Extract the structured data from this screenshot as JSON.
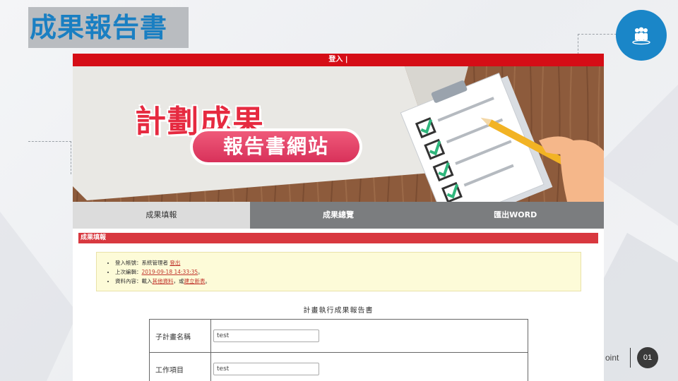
{
  "slide": {
    "title": "成果報告書",
    "footer_label": "oint",
    "page_number": "01",
    "accent_color": "#1a86c8",
    "badge_icon": "people-group-icon"
  },
  "site": {
    "topbar": {
      "login": "登入 |"
    },
    "banner": {
      "line1": "計劃成果",
      "line2": "報告書網站"
    },
    "nav": [
      {
        "label": "成果填報",
        "active": true
      },
      {
        "label": "成果總覽",
        "active": false
      },
      {
        "label": "匯出WORD",
        "active": false
      }
    ],
    "section_title": "成果填報",
    "info": {
      "account_prefix": "登入帳號：系統管理者",
      "logout_link": "登出",
      "last_edit_prefix": "上次編輯：",
      "last_edit_time": "2019-09-18 14:33:35",
      "last_edit_suffix": "。",
      "content_prefix": "資料內容：載入",
      "other_data_link": "其他資料",
      "content_mid": "，或",
      "new_form_link": "建立新表",
      "content_suffix": "。"
    },
    "report_title": "計畫執行成果報告書",
    "form": [
      {
        "label": "子計畫名稱",
        "value": "test"
      },
      {
        "label": "工作項目",
        "value": "test"
      }
    ],
    "colors": {
      "topbar": "#d50d16",
      "section": "#d8383f",
      "nav_inactive": "#7b7d7f"
    }
  }
}
